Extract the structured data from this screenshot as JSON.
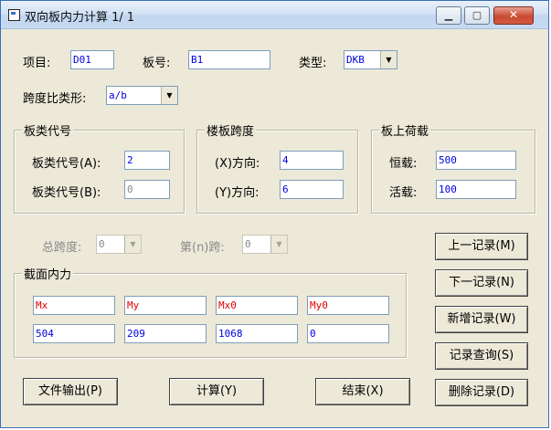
{
  "window": {
    "title": "双向板内力计算 1/ 1"
  },
  "fields": {
    "item_label": "项目:",
    "item_value": "D01",
    "slab_label": "板号:",
    "slab_value": "B1",
    "type_label": "类型:",
    "type_value": "DKB",
    "ratio_label": "跨度比类形:",
    "ratio_value": "a/b"
  },
  "group_slab_type": {
    "title": "板类代号",
    "a_label": "板类代号(A):",
    "a_value": "2",
    "b_label": "板类代号(B):",
    "b_value": "0"
  },
  "group_span": {
    "title": "楼板跨度",
    "x_label": "(X)方向:",
    "x_value": "4",
    "y_label": "(Y)方向:",
    "y_value": "6"
  },
  "group_load": {
    "title": "板上荷载",
    "dead_label": "恒载:",
    "dead_value": "500",
    "live_label": "活载:",
    "live_value": "100"
  },
  "span_row": {
    "total_label": "总跨度:",
    "total_value": "0",
    "nth_label": "第(n)跨:",
    "nth_value": "0"
  },
  "section": {
    "title": "截面内力",
    "headers": [
      "Mx",
      "My",
      "Mx0",
      "My0"
    ],
    "values": [
      "504",
      "209",
      "1068",
      "0"
    ]
  },
  "buttons": {
    "prev": "上一记录(M)",
    "next": "下一记录(N)",
    "add": "新增记录(W)",
    "query": "记录查询(S)",
    "delete": "删除记录(D)",
    "export": "文件输出(P)",
    "calc": "计算(Y)",
    "end": "结束(X)"
  },
  "colors": {
    "value_text": "#0000e0",
    "header_text": "#e00000",
    "window_bg": "#ece9d8"
  }
}
